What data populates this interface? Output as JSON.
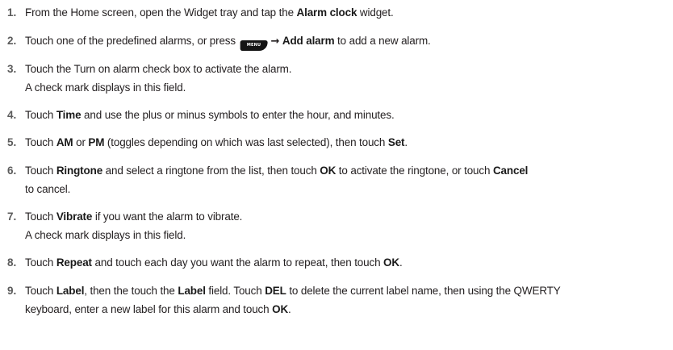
{
  "steps": [
    {
      "number": "1.",
      "parts": [
        "From the Home screen, open the Widget tray and tap the ",
        "Alarm clock",
        " widget."
      ]
    },
    {
      "number": "2.",
      "parts": [
        "Touch one of the predefined alarms, or press ",
        "MENU",
        "→",
        "Add alarm",
        " to add a new alarm."
      ]
    },
    {
      "number": "3.",
      "lines": [
        "Touch the Turn on alarm check box to activate the alarm.",
        "A check mark displays in this field."
      ]
    },
    {
      "number": "4.",
      "parts": [
        "Touch ",
        "Time",
        " and use the plus or minus symbols to enter the hour, and minutes."
      ]
    },
    {
      "number": "5.",
      "parts": [
        "Touch ",
        "AM",
        " or ",
        "PM",
        " (toggles depending on which was last selected), then touch ",
        "Set",
        "."
      ]
    },
    {
      "number": "6.",
      "parts": [
        "Touch ",
        "Ringtone",
        " and select a ringtone from the list, then touch ",
        "OK",
        " to activate the ringtone, or touch ",
        "Cancel",
        "to cancel."
      ]
    },
    {
      "number": "7.",
      "parts": [
        "Touch ",
        "Vibrate",
        " if you want the alarm to vibrate.",
        "A check mark displays in this field."
      ]
    },
    {
      "number": "8.",
      "parts": [
        "Touch ",
        "Repeat",
        " and touch each day you want the alarm to repeat, then touch ",
        "OK",
        "."
      ]
    },
    {
      "number": "9.",
      "parts": [
        "Touch ",
        "Label",
        ", then the touch the ",
        "Label",
        " field. Touch ",
        "DEL",
        " to delete the current label name, then using the QWERTY",
        "keyboard, enter a new label for this alarm and touch ",
        "OK",
        "."
      ]
    }
  ]
}
